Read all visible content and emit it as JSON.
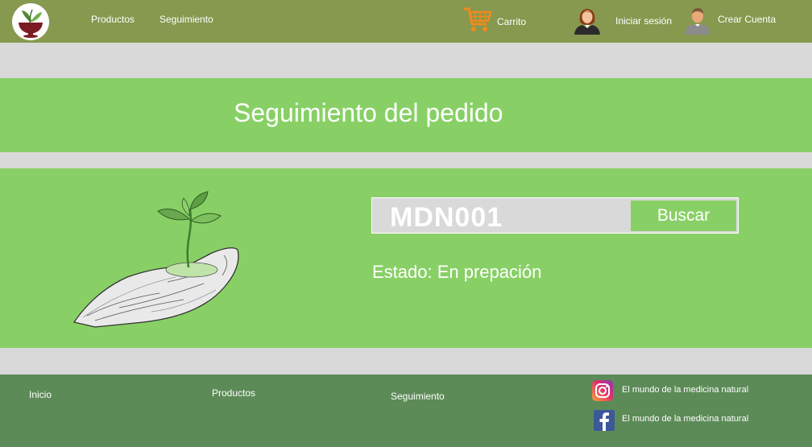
{
  "header": {
    "nav": [
      "Productos",
      "Seguimiento"
    ],
    "cart_label": "Carrito",
    "login_label": "Iniciar sesión",
    "signup_label": "Crear Cuenta"
  },
  "main": {
    "title": "Seguimiento del pedido",
    "search_value": "MDN001",
    "search_button": "Buscar",
    "status": "Estado: En prepación"
  },
  "footer": {
    "links": [
      "Inicio",
      "Productos",
      "Seguimiento"
    ],
    "social": [
      {
        "icon": "instagram-icon",
        "text": "El mundo de la medicina natural"
      },
      {
        "icon": "facebook-icon",
        "text": "El mundo de la medicina natural"
      }
    ]
  },
  "colors": {
    "header": "#86994f",
    "band": "#88d066",
    "footer": "#5c8b57",
    "page_bg": "#d9d9d9"
  }
}
